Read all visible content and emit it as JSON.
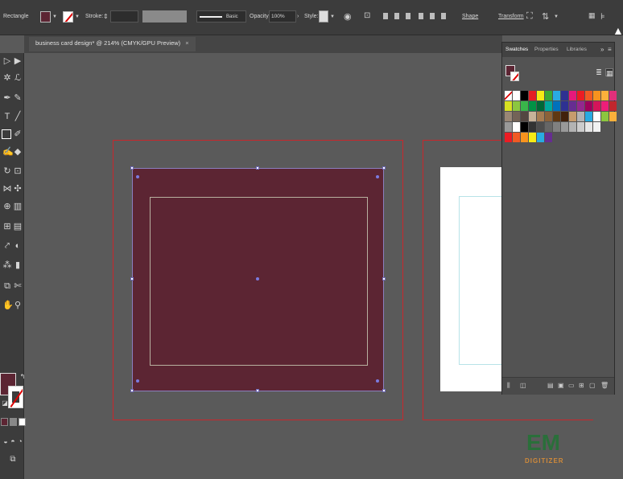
{
  "control_bar": {
    "selection_label": "Rectangle",
    "stroke_label": "Stroke:",
    "brush_label": "Basic",
    "opacity_label": "Opacity:",
    "opacity_value": "100%",
    "style_label": "Style:",
    "shape_label": "Shape",
    "transform_label": "Transform",
    "fill_color": "#5c2533"
  },
  "document_tab": {
    "title": "business card design* @ 214% (CMYK/GPU Preview)",
    "close": "×"
  },
  "panel": {
    "tabs": [
      "Swatches",
      "Properties",
      "Libraries"
    ],
    "menu": "»"
  },
  "swatches": {
    "rows": [
      [
        "none",
        "#ffffff",
        "#000000",
        "#e51e24",
        "#f6eb15",
        "#3aa935",
        "#29abe2",
        "#2e3192",
        "#e6197c",
        "#ec1c24",
        "#f15a24",
        "#f7931e",
        "#fbb03b",
        "#e22f7a"
      ],
      [
        "#d9e021",
        "#8cc63f",
        "#39b54a",
        "#009245",
        "#006837",
        "#00a99d",
        "#0071bc",
        "#2e3192",
        "#662d91",
        "#93278f",
        "#9e005d",
        "#d4145a",
        "#ed1e79",
        "#c1272d"
      ],
      [
        "#998675",
        "#736357",
        "#534741",
        "#c7b299",
        "#a67c52",
        "#8c6239",
        "#603813",
        "#42210b",
        "#c69c6d",
        "#b3b3b3",
        "#29abe2",
        "#ffffff",
        "#8cc63f",
        "#fbb03b"
      ],
      [
        "#999999",
        "#ffffff",
        "#000000",
        "#333333",
        "#4d4d4d",
        "#666666",
        "#808080",
        "#999999",
        "#b3b3b3",
        "#cccccc",
        "#e6e6e6",
        "#f2f2f2"
      ],
      [
        "#ec1c24",
        "#f15a24",
        "#f7931e",
        "#f6eb15",
        "#29abe2",
        "#662d91"
      ]
    ]
  },
  "watermark": {
    "logo": "EM",
    "tagline": "DIGITIZER"
  }
}
